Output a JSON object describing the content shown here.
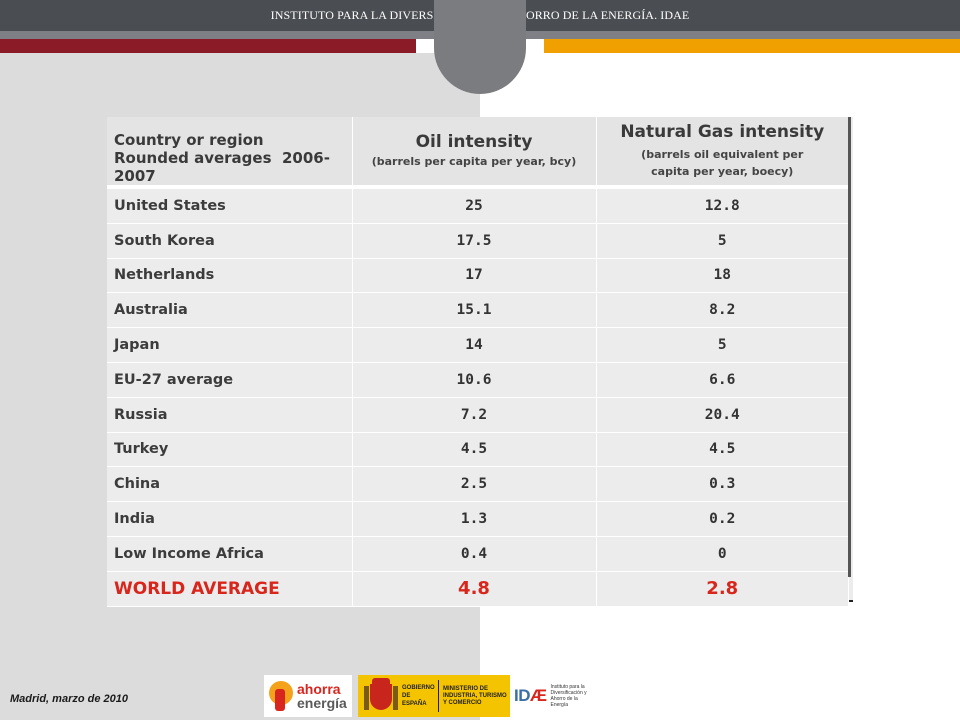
{
  "header": {
    "title": "INSTITUTO PARA LA DIVERSIFICACIÓN Y AHORRO DE LA ENERGÍA. IDAE"
  },
  "colors": {
    "top_bar": "#4a4d52",
    "red_band": "#8c1b28",
    "orange_band": "#f0a000",
    "left_panel": "#dcdcdc",
    "world_average_text": "#d9261c"
  },
  "table": {
    "header": {
      "country_line1": "Country or region",
      "country_line2_prefix": "Rounded averages",
      "country_line2_years": "2006-2007",
      "oil_title": "Oil intensity",
      "oil_sub": "(barrels per capita per year, bcy)",
      "gas_title": "Natural Gas intensity",
      "gas_sub_line1": "(barrels  oil equivalent per",
      "gas_sub_line2": "capita per year, boecy)"
    },
    "rows": [
      {
        "country": "United States",
        "oil": "25",
        "gas": "12.8"
      },
      {
        "country": "South Korea",
        "oil": "17.5",
        "gas": "5"
      },
      {
        "country": "Netherlands",
        "oil": "17",
        "gas": "18"
      },
      {
        "country": "Australia",
        "oil": "15.1",
        "gas": "8.2"
      },
      {
        "country": "Japan",
        "oil": "14",
        "gas": "5"
      },
      {
        "country": "EU-27 average",
        "oil": "10.6",
        "gas": "6.6"
      },
      {
        "country": "Russia",
        "oil": "7.2",
        "gas": "20.4"
      },
      {
        "country": "Turkey",
        "oil": "4.5",
        "gas": "4.5"
      },
      {
        "country": "China",
        "oil": "2.5",
        "gas": "0.3"
      },
      {
        "country": "India",
        "oil": "1.3",
        "gas": "0.2"
      },
      {
        "country": "Low Income Africa",
        "oil": "0.4",
        "gas": "0"
      }
    ],
    "world": {
      "country": "WORLD AVERAGE",
      "oil": "4.8",
      "gas": "2.8"
    }
  },
  "footer": {
    "date": "Madrid, marzo de 2010",
    "logos": {
      "ahorra_line1": "ahorra",
      "ahorra_line2": "energía",
      "gobierno": "GOBIERNO DE ESPAÑA",
      "ministerio": "MINISTERIO DE INDUSTRIA, TURISMO Y COMERCIO",
      "idae_prefix": "ID",
      "idae_e": "Æ",
      "idae_sub": "Instituto para la Diversificación y Ahorro de la Energía"
    }
  }
}
